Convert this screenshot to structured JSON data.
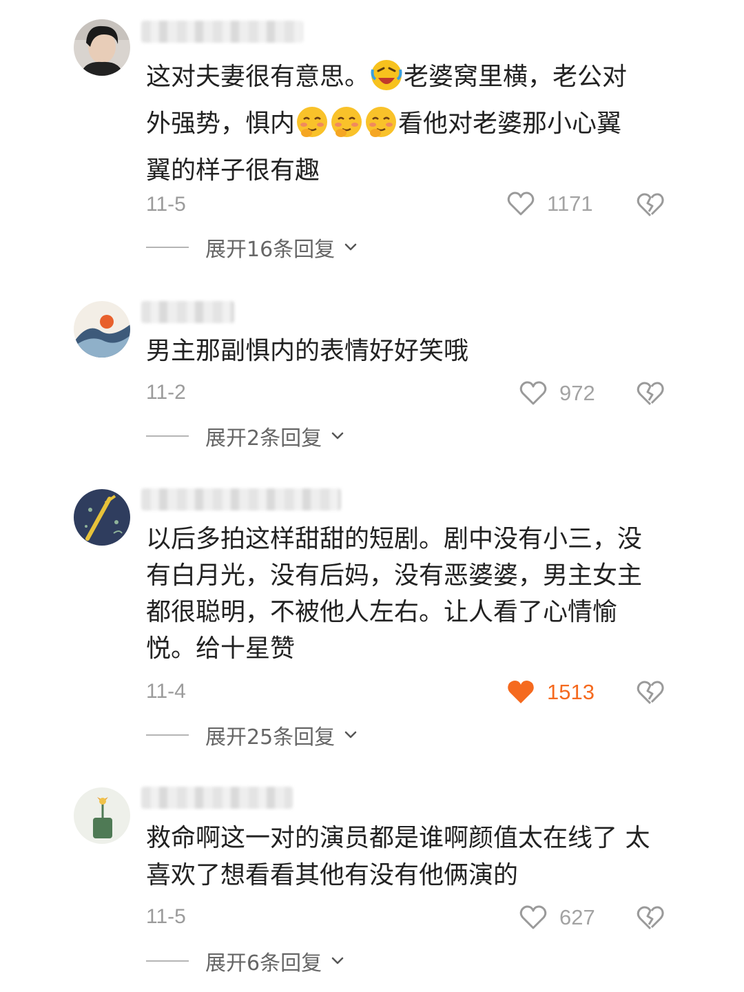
{
  "comments": [
    {
      "text_lines": [
        "这对夫妻很有意思。",
        "老婆窝里横，老公对",
        "外强势，惧内",
        "看他对老婆那小心翼",
        "翼的样子很有趣"
      ],
      "emoji": [
        "laughing-crying-face-emoji",
        "shy-face-emoji",
        "shy-face-emoji",
        "shy-face-emoji"
      ],
      "date": "11-5",
      "likes": "1171",
      "liked": false,
      "replies_label": "展开16条回复"
    },
    {
      "text_lines": [
        "男主那副惧内的表情好好笑哦"
      ],
      "date": "11-2",
      "likes": "972",
      "liked": false,
      "replies_label": "展开2条回复"
    },
    {
      "text_lines": [
        "以后多拍这样甜甜的短剧。剧中没有小三，没",
        "有白月光，没有后妈，没有恶婆婆，男主女主",
        "都很聪明，不被他人左右。让人看了心情愉",
        "悦。给十星赞"
      ],
      "date": "11-4",
      "likes": "1513",
      "liked": true,
      "replies_label": "展开25条回复"
    },
    {
      "text_lines": [
        "救命啊这一对的演员都是谁啊颜值太在线了 太",
        "喜欢了想看看其他有没有他俩演的"
      ],
      "date": "11-5",
      "likes": "627",
      "liked": false,
      "replies_label": "展开6条回复"
    }
  ],
  "colors": {
    "liked": "#f56a1f",
    "muted": "#9b9b9b",
    "text": "#222222"
  }
}
